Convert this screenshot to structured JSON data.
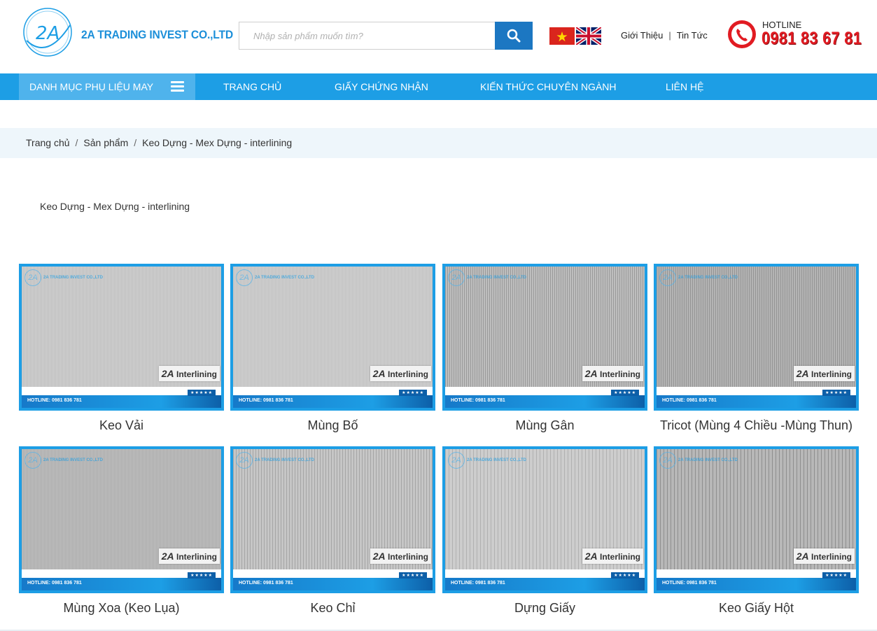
{
  "header": {
    "logo_text": "2A",
    "brand": "2A TRADING INVEST CO.,LTD",
    "search_placeholder": "Nhập sản phẩm muốn tìm?",
    "links": [
      {
        "label": "Giới Thiệu"
      },
      {
        "label": "Tin Tức"
      }
    ],
    "hotline_label": "HOTLINE",
    "hotline_number": "0981 83 67 81"
  },
  "nav": {
    "category_menu": "DANH MỤC PHỤ LIỆU MAY",
    "items": [
      {
        "label": "TRANG CHỦ"
      },
      {
        "label": "GIẤY CHỨNG NHẬN"
      },
      {
        "label": "KIẾN THỨC CHUYÊN NGÀNH"
      },
      {
        "label": "LIÊN HỆ"
      }
    ]
  },
  "breadcrumb": [
    {
      "label": "Trang chủ"
    },
    {
      "label": "Sản phẩm"
    },
    {
      "label": "Keo Dựng - Mex Dựng - interlining"
    }
  ],
  "page_title": "Keo Dựng - Mex Dựng - interlining",
  "image_watermark": {
    "logo": "2A",
    "company": "2A TRADING INVEST CO.,LTD",
    "tag_prefix": "2A",
    "tag_suffix": "Interlining",
    "hotline": "HOTLINE: 0981 836 781",
    "stars": "★★★★★"
  },
  "products": [
    {
      "name": "Keo Vải"
    },
    {
      "name": "Mùng Bố"
    },
    {
      "name": "Mùng Gân"
    },
    {
      "name": "Tricot (Mùng 4 Chiều -Mùng Thun)"
    },
    {
      "name": "Mùng Xoa (Keo Lụa)"
    },
    {
      "name": "Keo Chỉ"
    },
    {
      "name": "Dựng Giấy"
    },
    {
      "name": "Keo Giấy Hột"
    }
  ],
  "colors": {
    "primary": "#1d9ee5",
    "category_bg": "#4fb3ec",
    "search_button": "#1c77c2",
    "hotline": "#e11b22",
    "breadcrumb_bg": "#eef6fb"
  }
}
